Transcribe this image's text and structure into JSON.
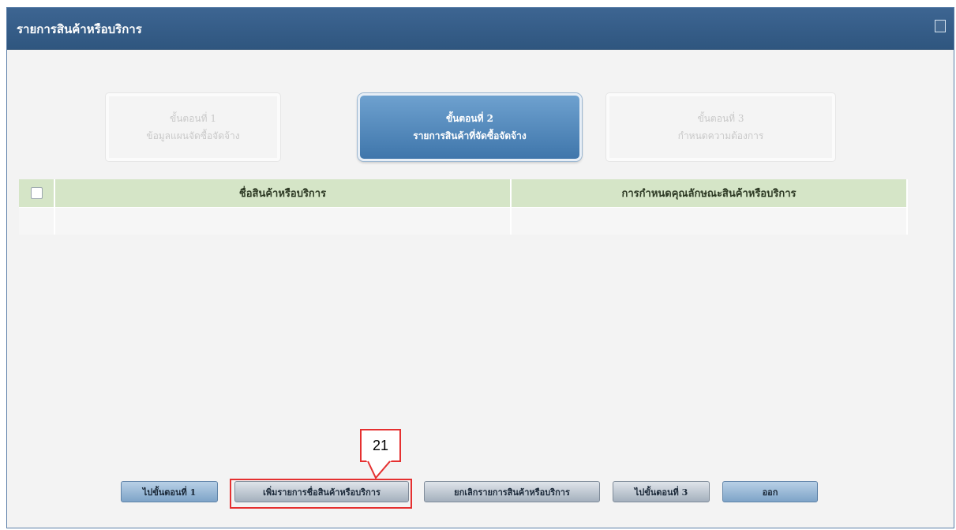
{
  "window": {
    "title": "รายการสินค้าหรือบริการ",
    "maximize_icon": "maximize-icon"
  },
  "steps": [
    {
      "line1": "ขั้นตอนที่ 1",
      "line2": "ข้อมูลแผนจัดซื้อจัดจ้าง",
      "state": "inactive"
    },
    {
      "line1": "ขั้นตอนที่ 2",
      "line2": "รายการสินค้าที่จัดซื้อจัดจ้าง",
      "state": "active"
    },
    {
      "line1": "ขั้นตอนที่ 3",
      "line2": "กำหนดความต้องการ",
      "state": "inactive"
    }
  ],
  "table": {
    "columns": [
      "ชื่อสินค้าหรือบริการ",
      "การกำหนดคุณลักษณะสินค้าหรือบริการ"
    ],
    "rows": []
  },
  "buttons": {
    "go_step1": "ไปขั้นตอนที่ 1",
    "add_item": "เพิ่มรายการชื่อสินค้าหรือบริการ",
    "cancel_item": "ยกเลิกรายการสินค้าหรือบริการ",
    "go_step3": "ไปขั้นตอนที่ 3",
    "exit": "ออก"
  },
  "annotation": {
    "callout_number": "21",
    "highlight_color": "#e53030"
  },
  "colors": {
    "titlebar": "#2f567f",
    "table_header": "#d5e5c7",
    "active_step": "#3f76ab"
  }
}
